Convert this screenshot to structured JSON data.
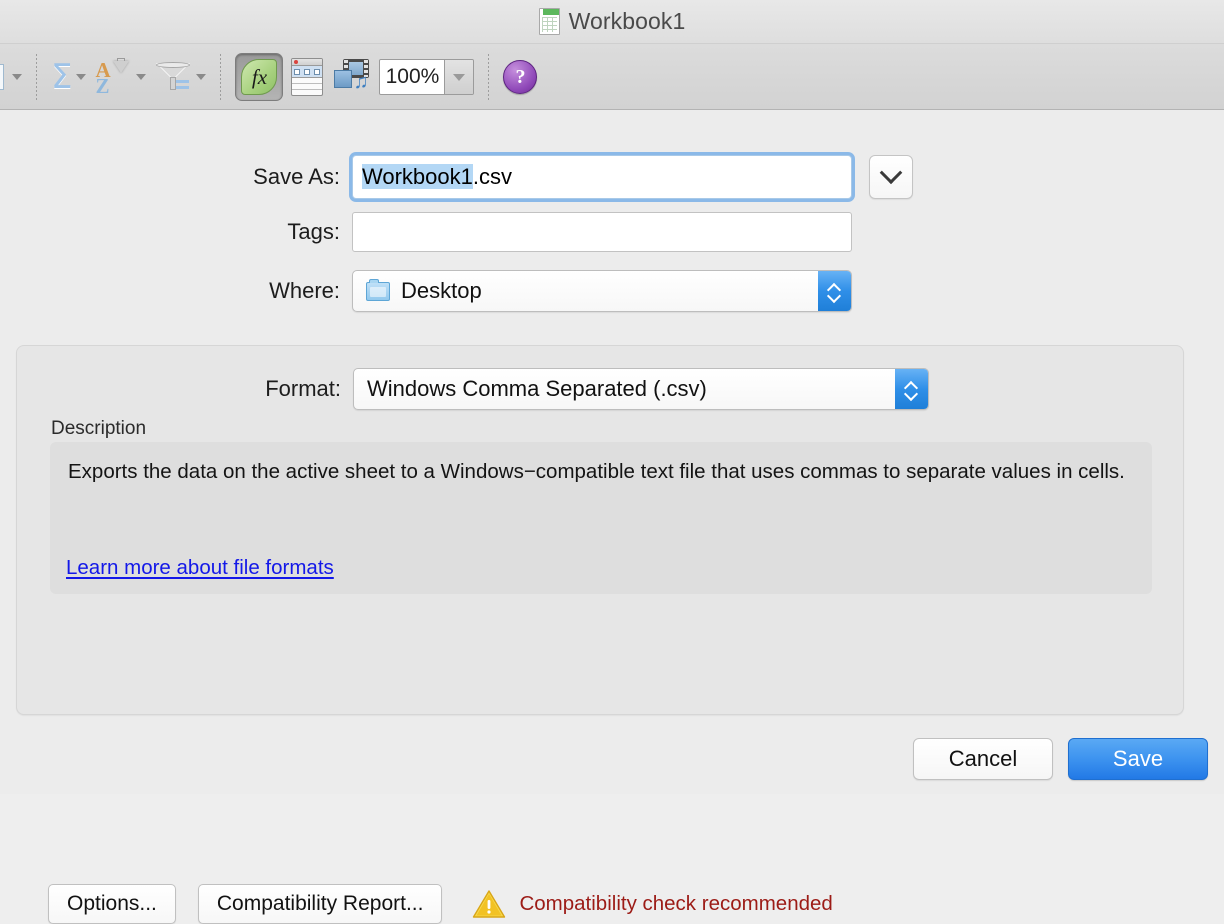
{
  "window": {
    "title": "Workbook1",
    "doc_icon": "excel-document-icon"
  },
  "toolbar": {
    "items": [
      {
        "name": "clipped-tool",
        "icon": "clipped-icon",
        "label": ""
      },
      {
        "name": "autosum",
        "icon": "sum-icon",
        "label": "Σ"
      },
      {
        "name": "sort",
        "icon": "sort-az-icon",
        "label": ""
      },
      {
        "name": "filter",
        "icon": "funnel-icon",
        "label": ""
      },
      {
        "name": "formula-builder",
        "icon": "fx-icon",
        "label": "fx"
      },
      {
        "name": "toolbox",
        "icon": "toolbox-icon",
        "label": ""
      },
      {
        "name": "media-browser",
        "icon": "media-browser-icon",
        "label": ""
      },
      {
        "name": "help",
        "icon": "help-icon",
        "label": "?"
      }
    ],
    "zoom_value": "100%"
  },
  "dialog": {
    "save_as": {
      "label": "Save As:",
      "value_selected": "Workbook1",
      "value_rest": ".csv",
      "full_value": "Workbook1.csv",
      "expand_icon": "chevron-down-icon"
    },
    "tags": {
      "label": "Tags:",
      "value": "",
      "placeholder": ""
    },
    "where": {
      "label": "Where:",
      "value": "Desktop",
      "icon": "folder-icon"
    },
    "format": {
      "label": "Format:",
      "value": "Windows Comma Separated (.csv)"
    },
    "description": {
      "title": "Description",
      "text": "Exports the data on the active sheet to a Windows−compatible text file that uses commas to separate values in cells.",
      "link": "Learn more about file formats"
    },
    "actions": {
      "options": "Options...",
      "compatibility_report": "Compatibility Report...",
      "warning_icon": "warning-triangle-icon",
      "warning_text": "Compatibility check recommended"
    },
    "footer": {
      "cancel": "Cancel",
      "save": "Save"
    }
  },
  "colors": {
    "accent_blue": "#2279e6",
    "focus_ring": "#7ab0e8",
    "selection_blue": "#b3d7f5",
    "link_blue": "#1318e8",
    "warning_text": "#9c1b16",
    "warning_yellow": "#f2c224",
    "fx_green": "#a7d17e",
    "help_purple": "#8f48b8"
  }
}
